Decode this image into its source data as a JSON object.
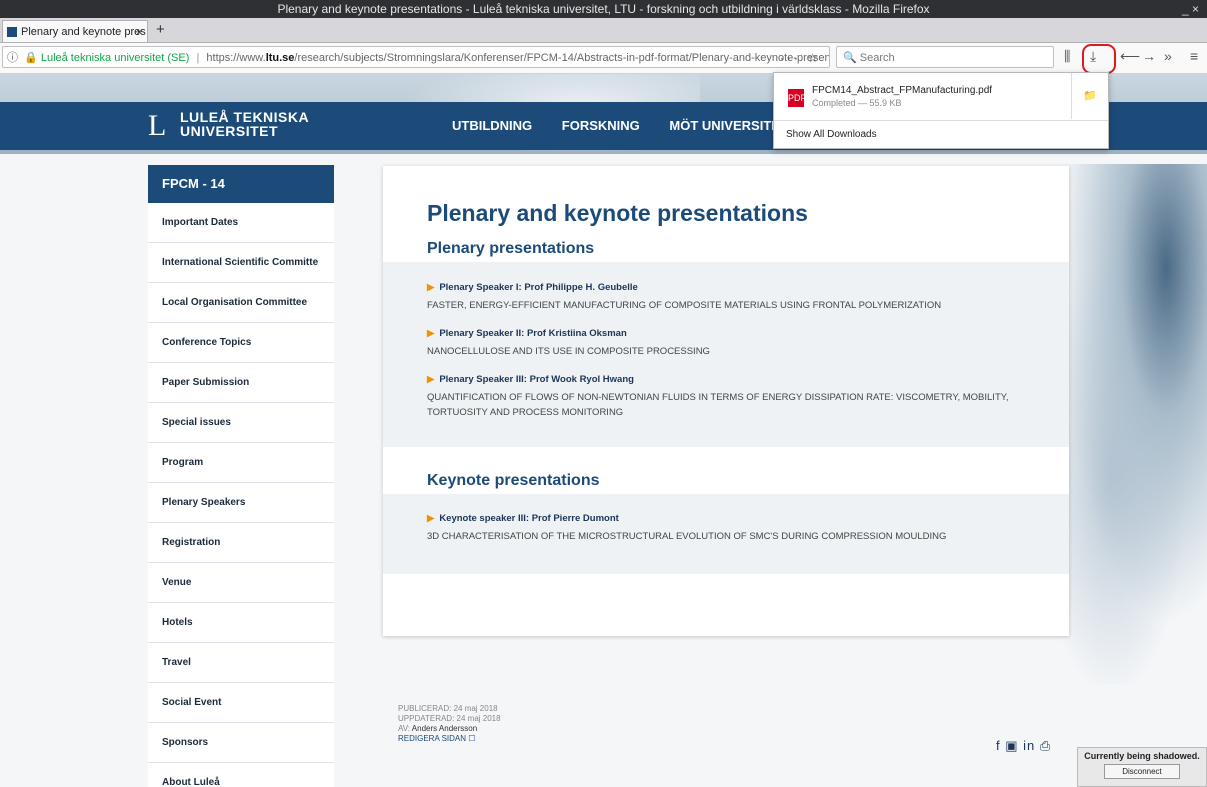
{
  "window": {
    "title": "Plenary and keynote presentations - Luleå tekniska universitet, LTU - forskning och utbildning i världsklass - Mozilla Firefox",
    "controls": "_ ×"
  },
  "tab": {
    "label": "Plenary and keynote pres",
    "close": "×",
    "new_tab": "+"
  },
  "urlbar": {
    "info_icon": "ⓘ",
    "lock_icon": "🔒",
    "site_identity": "Luleå tekniska universitet (SE)",
    "url_prefix": "https://www.",
    "url_domain": "ltu.se",
    "url_path": "/research/subjects/Stromningslara/Konferenser/FPCM-14/Abstracts-in-pdf-format/Plenary-and-keynote-presentations",
    "page_actions": "··· ☆"
  },
  "search": {
    "placeholder": "Search",
    "icon": "🔍"
  },
  "toolbar": {
    "library": "⫼",
    "downloads": "⤓",
    "back": "⟵",
    "forward": "→",
    "overflow": "»",
    "menu": "≡"
  },
  "downloads_panel": {
    "file_name": "FPCM14_Abstract_FPManufacturing.pdf",
    "status": "Completed — 55.9 KB",
    "pdf_icon": "PDF",
    "folder_icon": "📁",
    "show_all": "Show All Downloads"
  },
  "site": {
    "logo_mark": "L",
    "logo_line1": "LULEÅ TEKNISKA",
    "logo_line2": "UNIVERSITET",
    "nav": [
      "UTBILDNING",
      "FORSKNING",
      "MÖT UNIVERSITET"
    ]
  },
  "sidebar": {
    "header": "FPCM - 14",
    "items": [
      "Important Dates",
      "International Scientific Committe",
      "Local Organisation Committee",
      "Conference Topics",
      "Paper Submission",
      "Special issues",
      "Program",
      "Plenary Speakers",
      "Registration",
      "Venue",
      "Hotels",
      "Travel",
      "Social Event",
      "Sponsors",
      "About Luleå"
    ]
  },
  "content": {
    "title": "Plenary and keynote presentations",
    "plenary_heading": "Plenary presentations",
    "plenary": [
      {
        "speaker": "Plenary Speaker I: Prof Philippe H. Geubelle",
        "topic": "FASTER, ENERGY-EFFICIENT MANUFACTURING OF COMPOSITE MATERIALS USING FRONTAL POLYMERIZATION"
      },
      {
        "speaker": "Plenary Speaker II: Prof Kristiina Oksman",
        "topic": "NANOCELLULOSE AND ITS USE IN COMPOSITE PROCESSING"
      },
      {
        "speaker": "Plenary Speaker III: Prof Wook Ryol Hwang",
        "topic": "QUANTIFICATION OF FLOWS OF NON-NEWTONIAN FLUIDS IN TERMS OF ENERGY DISSIPATION RATE: VISCOMETRY, MOBILITY, TORTUOSITY AND PROCESS MONITORING"
      }
    ],
    "keynote_heading": "Keynote presentations",
    "keynote": [
      {
        "speaker": "Keynote speaker III: Prof Pierre Dumont",
        "topic": "3D CHARACTERISATION OF THE MICROSTRUCTURAL EVOLUTION OF SMC'S DURING COMPRESSION MOULDING"
      }
    ],
    "arrow": "▶"
  },
  "meta": {
    "published": "PUBLICERAD: 24 maj 2018",
    "updated": "UPPDATERAD: 24 maj 2018",
    "author_label": "AV: ",
    "author": "Anders Andersson",
    "edit": "REDIGERA SIDAN ☐"
  },
  "social": "f ▣ in ⎙",
  "shadow": {
    "message": "Currently being shadowed.",
    "button": "Disconnect"
  },
  "colors": {
    "brand": "#1c4b7a",
    "accent": "#f39200",
    "highlight": "#e0171f"
  }
}
